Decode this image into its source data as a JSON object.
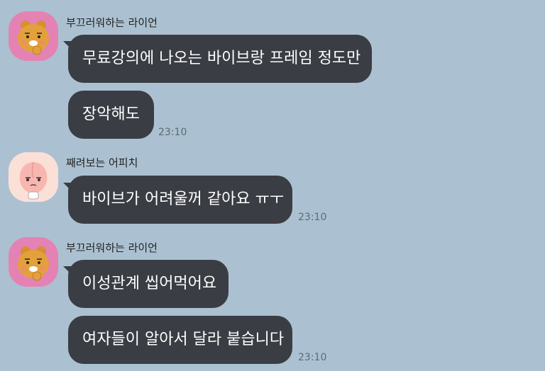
{
  "messages": [
    {
      "sender": "부끄러워하는 라이언",
      "avatar_icon": "ryan-avatar-icon",
      "bubbles": [
        {
          "text": "무료강의에 나오는 바이브랑 프레임 정도만",
          "time": ""
        },
        {
          "text": "장악해도",
          "time": "23:10"
        }
      ]
    },
    {
      "sender": "째려보는 어피치",
      "avatar_icon": "apeach-avatar-icon",
      "bubbles": [
        {
          "text": "바이브가 어려울꺼 같아요 ㅠㅜ",
          "time": "23:10"
        }
      ]
    },
    {
      "sender": "부끄러워하는 라이언",
      "avatar_icon": "ryan-avatar-icon",
      "bubbles": [
        {
          "text": "이성관계 씹어먹어요",
          "time": ""
        },
        {
          "text": "여자들이 알아서 달라 붙습니다",
          "time": "23:10"
        }
      ]
    }
  ],
  "colors": {
    "background": "#abc1d1",
    "bubble": "#3a3d43",
    "ryan_bg": "#e482b4",
    "apeach_bg": "#fbe0d8"
  }
}
